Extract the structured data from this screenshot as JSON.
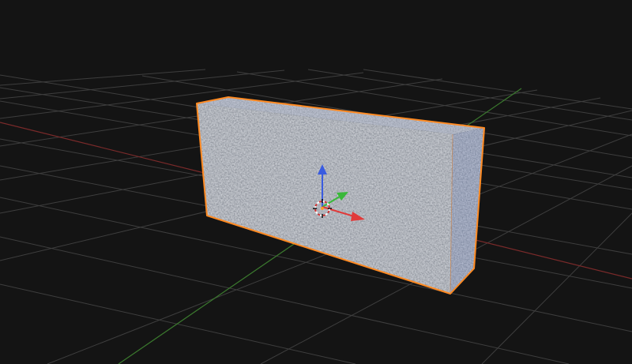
{
  "viewport": {
    "background": "#141414",
    "grid_color": "#3e3e3e",
    "axis_x_color": "#7a2a2a",
    "axis_y_color": "#3b7a2e"
  },
  "selected_object": {
    "type": "cube",
    "outline_color": "#ff8a22",
    "material": "concrete-texture"
  },
  "gizmo": {
    "x_color": "#e03a3a",
    "y_color": "#3ab83a",
    "z_color": "#3a5ce0",
    "cursor_color_a": "#ffffff",
    "cursor_color_b": "#d03030"
  }
}
